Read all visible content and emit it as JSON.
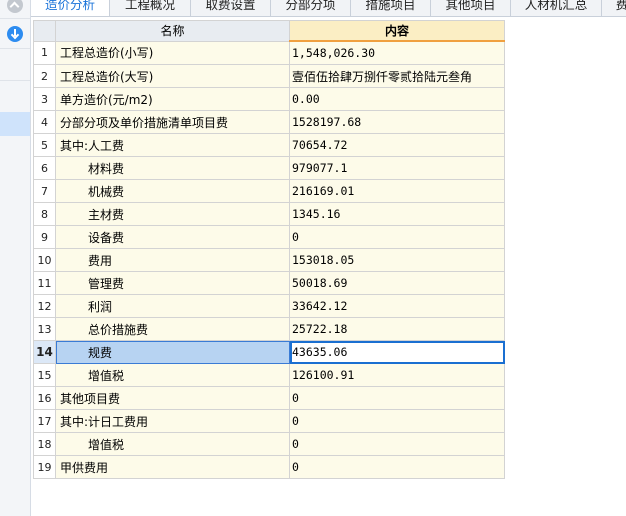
{
  "tabs": [
    {
      "label": "造价分析",
      "active": true
    },
    {
      "label": "工程概况",
      "active": false
    },
    {
      "label": "取费设置",
      "active": false
    },
    {
      "label": "分部分项",
      "active": false
    },
    {
      "label": "措施项目",
      "active": false
    },
    {
      "label": "其他项目",
      "active": false
    },
    {
      "label": "人材机汇总",
      "active": false
    },
    {
      "label": "费",
      "active": false
    }
  ],
  "sidebar": {
    "icons": [
      "collapse-up-icon",
      "download-icon"
    ]
  },
  "table": {
    "headers": {
      "name": "名称",
      "content": "内容"
    },
    "selected_row": 14,
    "rows": [
      {
        "no": "1",
        "name": "工程总造价(小写)",
        "value": "1,548,026.30",
        "indent": false
      },
      {
        "no": "2",
        "name": "工程总造价(大写)",
        "value": "壹佰伍拾肆万捌仟零贰拾陆元叁角",
        "indent": false
      },
      {
        "no": "3",
        "name": "单方造价(元/m2)",
        "value": "0.00",
        "indent": false
      },
      {
        "no": "4",
        "name": "分部分项及单价措施清单项目费",
        "value": "1528197.68",
        "indent": false
      },
      {
        "no": "5",
        "name": "其中:人工费",
        "value": "70654.72",
        "indent": false
      },
      {
        "no": "6",
        "name": "材料费",
        "value": "979077.1",
        "indent": true
      },
      {
        "no": "7",
        "name": "机械费",
        "value": "216169.01",
        "indent": true
      },
      {
        "no": "8",
        "name": "主材费",
        "value": "1345.16",
        "indent": true
      },
      {
        "no": "9",
        "name": "设备费",
        "value": "0",
        "indent": true
      },
      {
        "no": "10",
        "name": "费用",
        "value": "153018.05",
        "indent": true
      },
      {
        "no": "11",
        "name": "管理费",
        "value": "50018.69",
        "indent": true
      },
      {
        "no": "12",
        "name": "利润",
        "value": "33642.12",
        "indent": true
      },
      {
        "no": "13",
        "name": "总价措施费",
        "value": "25722.18",
        "indent": true
      },
      {
        "no": "14",
        "name": "规费",
        "value": "43635.06",
        "indent": true
      },
      {
        "no": "15",
        "name": "增值税",
        "value": "126100.91",
        "indent": true
      },
      {
        "no": "16",
        "name": "其他项目费",
        "value": "0",
        "indent": false
      },
      {
        "no": "17",
        "name": "其中:计日工费用",
        "value": "0",
        "indent": false
      },
      {
        "no": "18",
        "name": "增值税",
        "value": "0",
        "indent": true
      },
      {
        "no": "19",
        "name": "甲供费用",
        "value": "0",
        "indent": false
      }
    ]
  },
  "colors": {
    "accent": "#1a73d9",
    "cell_bg": "#fdfbe9",
    "header_content_bg": "#fbeec4",
    "selected_name_bg": "#b7d3f2"
  }
}
